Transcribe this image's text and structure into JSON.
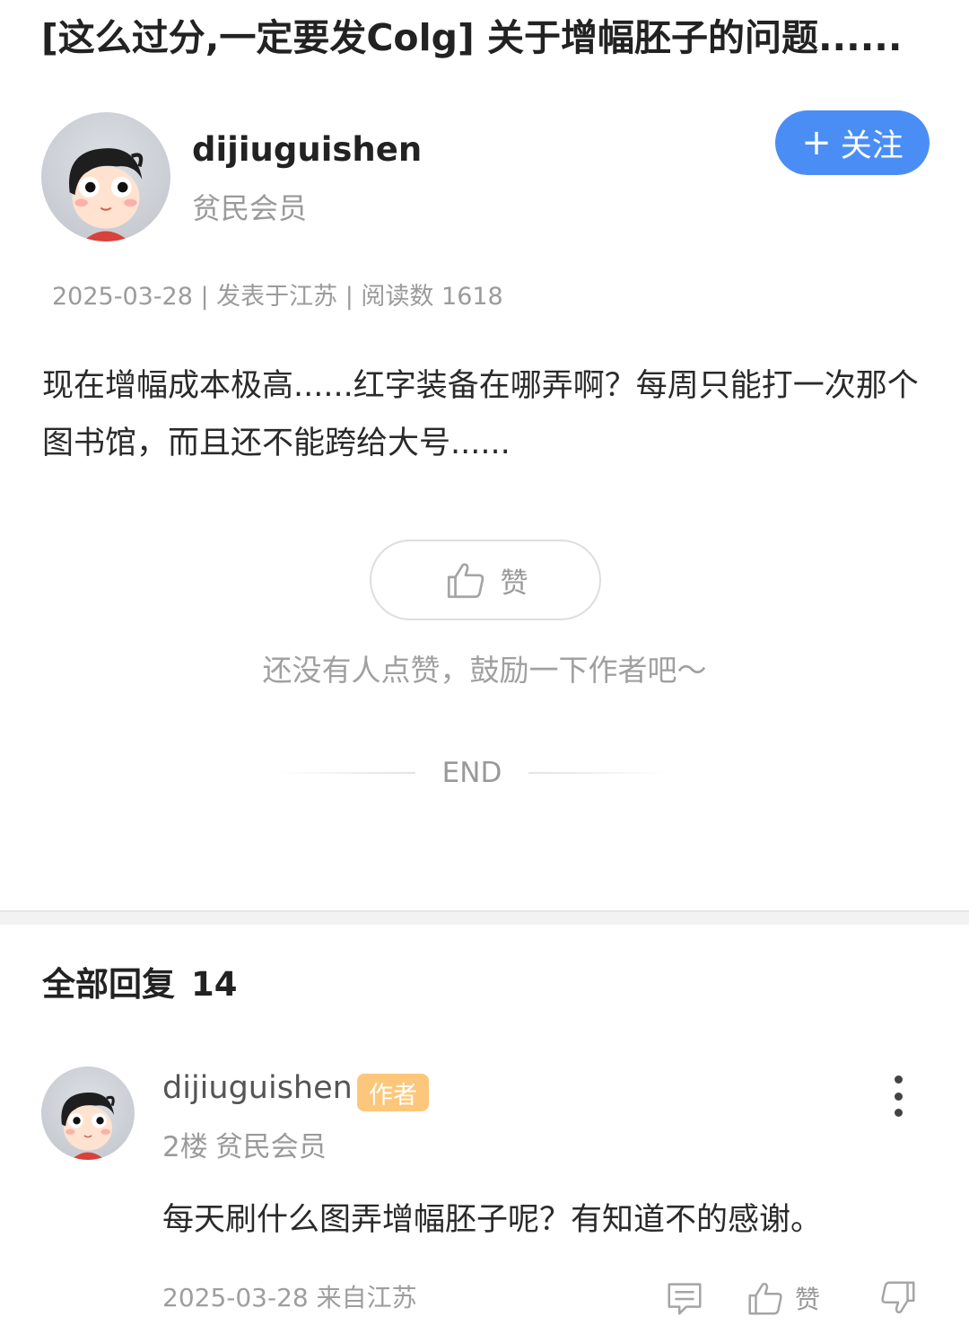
{
  "post": {
    "title": "[这么过分,一定要发Colg] 关于增幅胚子的问题......",
    "author": {
      "name": "dijiuguishen",
      "role": "贫民会员",
      "follow_label": "关注",
      "follow_plus": "+"
    },
    "meta": "2025-03-28 | 发表于江苏 | 阅读数 1618",
    "body": "现在增幅成本极高......红字装备在哪弄啊？每周只能打一次那个图书馆，而且还不能跨给大号......",
    "like_label": "赞",
    "like_hint": "还没有人点赞，鼓励一下作者吧～",
    "end_label": "END"
  },
  "replies": {
    "header_label": "全部回复",
    "count": "14",
    "items": [
      {
        "name": "dijiuguishen",
        "badge": "作者",
        "floor": "2楼",
        "role": "贫民会员",
        "body": "每天刷什么图弄增幅胚子呢？有知道不的感谢。",
        "meta": "2025-03-28 来自江苏",
        "like_label": "赞"
      }
    ]
  },
  "colors": {
    "accent": "#4a8ef5",
    "author_badge": "#fcc77a"
  },
  "icons": [
    "avatar",
    "thumbs-up-icon",
    "comment-icon",
    "thumbs-down-icon",
    "more-vertical-icon"
  ]
}
